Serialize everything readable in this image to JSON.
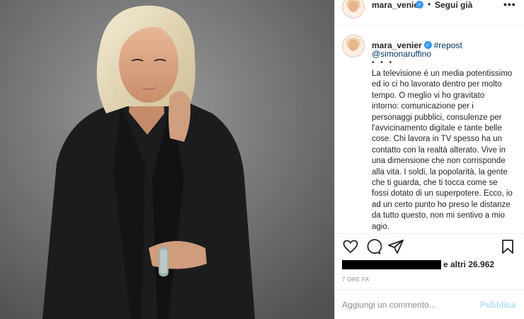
{
  "post": {
    "image_alt_icon": "portrait-photo",
    "header": {
      "username": "mara_venier",
      "verified_icon": "verified-badge",
      "separator": "•",
      "follow_label": "Segui già",
      "more_icon": "ellipsis"
    },
    "caption": {
      "username": "mara_venier",
      "hashtag": "#repost",
      "mention": "@simonaruffino",
      "dots": "• • •",
      "text": "La televisione é un media potentissimo ed io ci ho lavorato dentro per molto tempo. O meglio vi ho gravitato intorno: comunicazione per i personaggi pubblici, consulenze per l'avvicinamento digitale e tante belle cose. Chi lavora in TV spesso ha un contatto con la realtà alterato. Vive in una dimensione che non corrisponde alla vita. I soldi, la popolarità, la gente che ti guarda, che ti tocca come se fossi dotato di un superpotere. Ecco, io ad un certo punto ho preso le distanze da tutto questo, non mi sentivo a mio agio."
    },
    "actions": {
      "like_icon": "heart",
      "comment_icon": "speech-bubble",
      "share_icon": "paper-plane",
      "save_icon": "bookmark"
    },
    "likes_text": "e altri 26.962",
    "timestamp": "7 ORE FA",
    "comment_box": {
      "placeholder": "Aggiungi un commento...",
      "publish_label": "Pubblica"
    }
  },
  "colors": {
    "link": "#003569",
    "verified": "#3897f0",
    "publish_disabled": "#b2dffc",
    "muted": "#8e8e8e"
  }
}
